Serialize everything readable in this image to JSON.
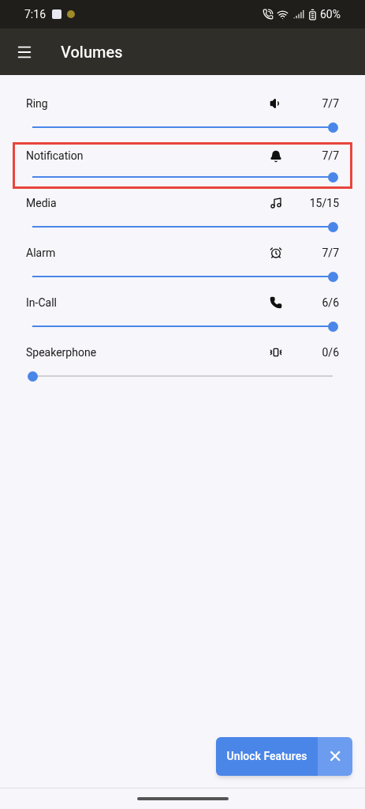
{
  "status_bar": {
    "time": "7:16",
    "battery": "60%"
  },
  "app_bar": {
    "title": "Volumes"
  },
  "volumes": [
    {
      "name": "Ring",
      "reading": "7/7",
      "level": 1,
      "highlighted": false
    },
    {
      "name": "Notification",
      "reading": "7/7",
      "level": 1,
      "highlighted": true
    },
    {
      "name": "Media",
      "reading": "15/15",
      "level": 1,
      "highlighted": false
    },
    {
      "name": "Alarm",
      "reading": "7/7",
      "level": 1,
      "highlighted": false
    },
    {
      "name": "In-Call",
      "reading": "6/6",
      "level": 1,
      "highlighted": false
    },
    {
      "name": "Speakerphone",
      "reading": "0/6",
      "level": 0,
      "highlighted": false
    }
  ],
  "unlock_button": {
    "label": "Unlock Features",
    "close": "✕"
  }
}
